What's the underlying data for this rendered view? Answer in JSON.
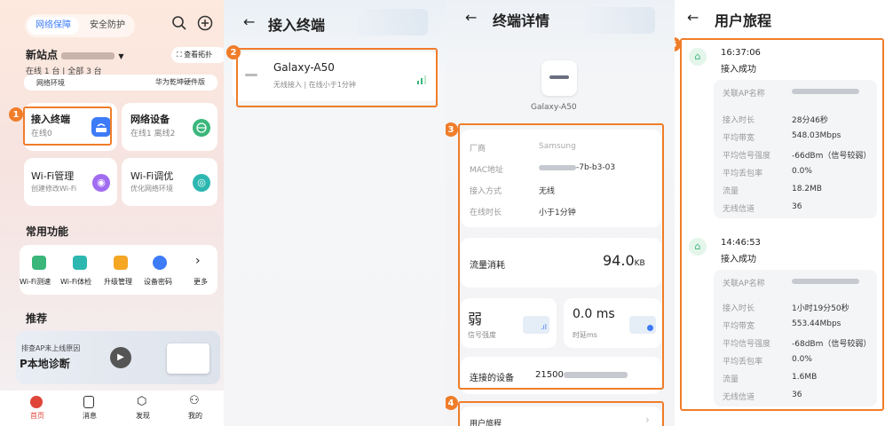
{
  "panel1": {
    "tabs": [
      "网络保障",
      "安全防护"
    ],
    "site_name": "新站点",
    "status_line": "在线 1 台 | 全部 3 台",
    "view_topology": "查看拓扑",
    "network_env": "网络环境",
    "firmware": "华为乾坤硬件版",
    "cards": [
      {
        "title": "接入终端",
        "sub": "在线0"
      },
      {
        "title": "网络设备",
        "sub": "在线1 离线2"
      },
      {
        "title": "Wi-Fi管理",
        "sub": "创建修改Wi-Fi"
      },
      {
        "title": "Wi-Fi调优",
        "sub": "优化网络环境"
      }
    ],
    "common_title": "常用功能",
    "common_items": [
      "Wi-Fi测速",
      "Wi-Fi体检",
      "升级管理",
      "设备密码",
      "更多"
    ],
    "recommend_title": "推荐",
    "recommend_line1": "排查AP未上线原因",
    "recommend_line2": "P本地诊断",
    "bottom_nav": [
      "首页",
      "消息",
      "发现",
      "我的"
    ]
  },
  "panel2": {
    "title": "接入终端",
    "device_name": "Galaxy-A50",
    "device_access": "无线接入",
    "device_online": "在线小于1分钟"
  },
  "panel3": {
    "title": "终端详情",
    "device_name": "Galaxy-A50",
    "info": [
      {
        "label": "厂商",
        "value": "Samsung"
      },
      {
        "label": "MAC地址",
        "value": "-7b-b3-03"
      },
      {
        "label": "接入方式",
        "value": "无线"
      },
      {
        "label": "在线时长",
        "value": "小于1分钟"
      }
    ],
    "traffic_label": "流量消耗",
    "traffic_value": "94.0",
    "traffic_unit": "KB",
    "signal_value": "弱",
    "signal_label": "信号强度",
    "latency_value": "0.0 ms",
    "latency_label": "时延ms",
    "connected_label": "连接的设备",
    "connected_value": "21500",
    "journey_label": "用户旅程"
  },
  "panel4": {
    "title": "用户旅程",
    "events": [
      {
        "time": "16:37:06",
        "status": "接入成功",
        "rows": [
          {
            "label": "关联AP名称",
            "value": ""
          },
          {
            "label": "接入时长",
            "value": "28分46秒"
          },
          {
            "label": "平均带宽",
            "value": "548.03Mbps"
          },
          {
            "label": "平均信号强度",
            "value": "-66dBm（信号较弱）"
          },
          {
            "label": "平均丢包率",
            "value": "0.0%"
          },
          {
            "label": "流量",
            "value": "18.2MB"
          },
          {
            "label": "无线信道",
            "value": "36"
          }
        ]
      },
      {
        "time": "14:46:53",
        "status": "接入成功",
        "rows": [
          {
            "label": "关联AP名称",
            "value": ""
          },
          {
            "label": "接入时长",
            "value": "1小时19分50秒"
          },
          {
            "label": "平均带宽",
            "value": "553.44Mbps"
          },
          {
            "label": "平均信号强度",
            "value": "-68dBm（信号较弱）"
          },
          {
            "label": "平均丢包率",
            "value": "0.0%"
          },
          {
            "label": "流量",
            "value": "1.6MB"
          },
          {
            "label": "无线信道",
            "value": "36"
          }
        ]
      }
    ]
  },
  "badges": [
    "1",
    "2",
    "3",
    "4",
    "5"
  ],
  "colors": {
    "accent": "#3d7bf7",
    "highlight": "#f07d2a",
    "green": "#3ab67a"
  }
}
